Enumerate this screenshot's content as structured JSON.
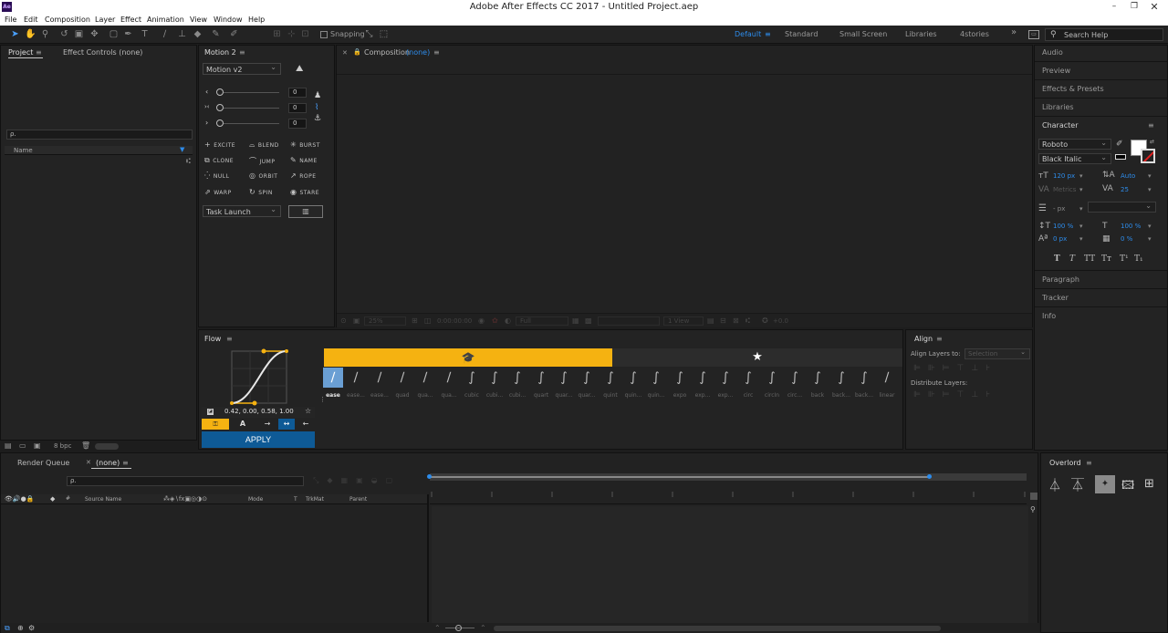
{
  "app": {
    "title": "Adobe After Effects CC 2017 - Untitled Project.aep",
    "icon_label": "Ae"
  },
  "menu": [
    "File",
    "Edit",
    "Composition",
    "Layer",
    "Effect",
    "Animation",
    "View",
    "Window",
    "Help"
  ],
  "toolbar": {
    "snapping_label": "Snapping",
    "workspaces": [
      "Default",
      "Standard",
      "Small Screen",
      "Libraries",
      "4stories"
    ],
    "active_workspace": "Default",
    "search_placeholder": "Search Help"
  },
  "project_panel": {
    "tabs": [
      "Project",
      "Effect Controls (none)"
    ],
    "search_prefix": "ρ.",
    "name_column": "Name",
    "footer_bpc": "8 bpc"
  },
  "motion_panel": {
    "title": "Motion 2",
    "version": "Motion v2",
    "sliders": [
      {
        "value": "0"
      },
      {
        "value": "0"
      },
      {
        "value": "0"
      }
    ],
    "buttons": [
      {
        "icon": "+",
        "label": "EXCITE"
      },
      {
        "icon": "⌓",
        "label": "BLEND"
      },
      {
        "icon": "✳",
        "label": "BURST"
      },
      {
        "icon": "⧉",
        "label": "CLONE"
      },
      {
        "icon": "⌒",
        "label": "JUMP"
      },
      {
        "icon": "✎",
        "label": "NAME"
      },
      {
        "icon": "⁛",
        "label": "NULL"
      },
      {
        "icon": "◎",
        "label": "ORBIT"
      },
      {
        "icon": "↗",
        "label": "ROPE"
      },
      {
        "icon": "⇗",
        "label": "WARP"
      },
      {
        "icon": "↻",
        "label": "SPIN"
      },
      {
        "icon": "◉",
        "label": "STARE"
      }
    ],
    "task_dropdown": "Task Launch"
  },
  "composition_panel": {
    "title": "Composition",
    "comp_name": "(none)",
    "footer": {
      "zoom": "25%",
      "timecode": "0:00:00:00",
      "resolution": "Full",
      "view": "1 View",
      "exposure": "+0.0"
    }
  },
  "flow_panel": {
    "title": "Flow",
    "bezier_values": "0.42, 0.00, 0.58, 1.00",
    "apply_label": "APPLY",
    "eases": [
      "ease",
      "ease...",
      "ease...",
      "quad",
      "qua...",
      "qua...",
      "cubic",
      "cubi...",
      "cubi...",
      "quart",
      "quar...",
      "quar...",
      "quint",
      "quin...",
      "quin...",
      "expo",
      "exp...",
      "exp...",
      "circ",
      "circIn",
      "circ...",
      "back",
      "back...",
      "back...",
      "linear"
    ],
    "selected_ease": "ease",
    "colors": {
      "tab_yellow": "#f5b211",
      "apply_blue": "#0e5a96"
    }
  },
  "align_panel": {
    "title": "Align",
    "align_to_label": "Align Layers to:",
    "align_to_value": "Selection",
    "distribute_label": "Distribute Layers:"
  },
  "right_panels": [
    "Audio",
    "Preview",
    "Effects & Presets",
    "Libraries"
  ],
  "character_panel": {
    "title": "Character",
    "font": "Roboto",
    "style": "Black Italic",
    "size": "120 px",
    "leading": "Auto",
    "kerning": "Metrics",
    "tracking": "25",
    "stroke_width": "- px",
    "vscale": "100 %",
    "hscale": "100 %",
    "baseline": "0 px",
    "tsume": "0 %",
    "type_styles": [
      "T",
      "T",
      "TT",
      "Tт",
      "T¹",
      "T₁"
    ]
  },
  "bottom_right_panels": [
    "Paragraph",
    "Tracker",
    "Info"
  ],
  "timeline": {
    "tabs": [
      "Render Queue",
      "(none)"
    ],
    "columns": {
      "source": "Source Name",
      "mode": "Mode",
      "t": "T",
      "trkmat": "TrkMat",
      "parent": "Parent",
      "hash": "#"
    }
  },
  "overlord": {
    "title": "Overlord"
  }
}
